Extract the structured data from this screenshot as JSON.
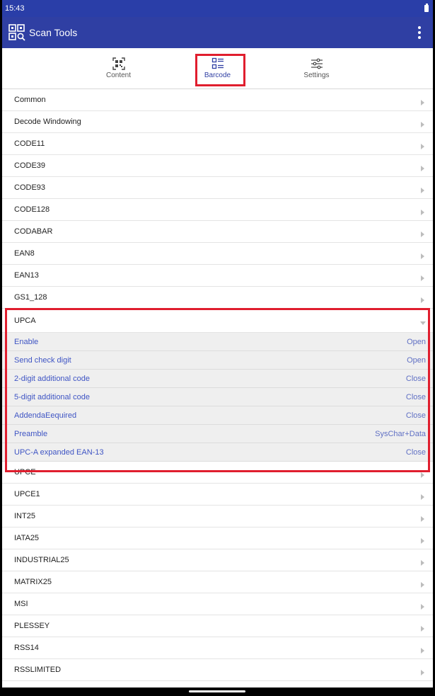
{
  "status": {
    "time": "15:43"
  },
  "app": {
    "title": "Scan Tools"
  },
  "tabs": [
    {
      "label": "Content",
      "icon": "qr-scan-icon",
      "active": false
    },
    {
      "label": "Barcode",
      "icon": "barcode-list-icon",
      "active": true
    },
    {
      "label": "Settings",
      "icon": "sliders-icon",
      "active": false
    }
  ],
  "list_top": [
    "Common",
    "Decode Windowing",
    "CODE11",
    "CODE39",
    "CODE93",
    "CODE128",
    "CODABAR",
    "EAN8",
    "EAN13",
    "GS1_128"
  ],
  "expanded": {
    "title": "UPCA",
    "items": [
      {
        "label": "Enable",
        "value": "Open"
      },
      {
        "label": "Send check digit",
        "value": "Open"
      },
      {
        "label": "2-digit additional code",
        "value": "Close"
      },
      {
        "label": "5-digit additional code",
        "value": "Close"
      },
      {
        "label": "AddendaEequired",
        "value": "Close"
      },
      {
        "label": "Preamble",
        "value": "SysChar+Data"
      },
      {
        "label": "UPC-A expanded EAN-13",
        "value": "Close"
      }
    ]
  },
  "list_bottom": [
    "UPCE",
    "UPCE1",
    "INT25",
    "IATA25",
    "INDUSTRIAL25",
    "MATRIX25",
    "MSI",
    "PLESSEY",
    "RSS14",
    "RSSLIMITED"
  ],
  "colors": {
    "primary": "#2f3fa3",
    "highlight": "#e01e2e",
    "sub_text": "#3f55c4"
  }
}
